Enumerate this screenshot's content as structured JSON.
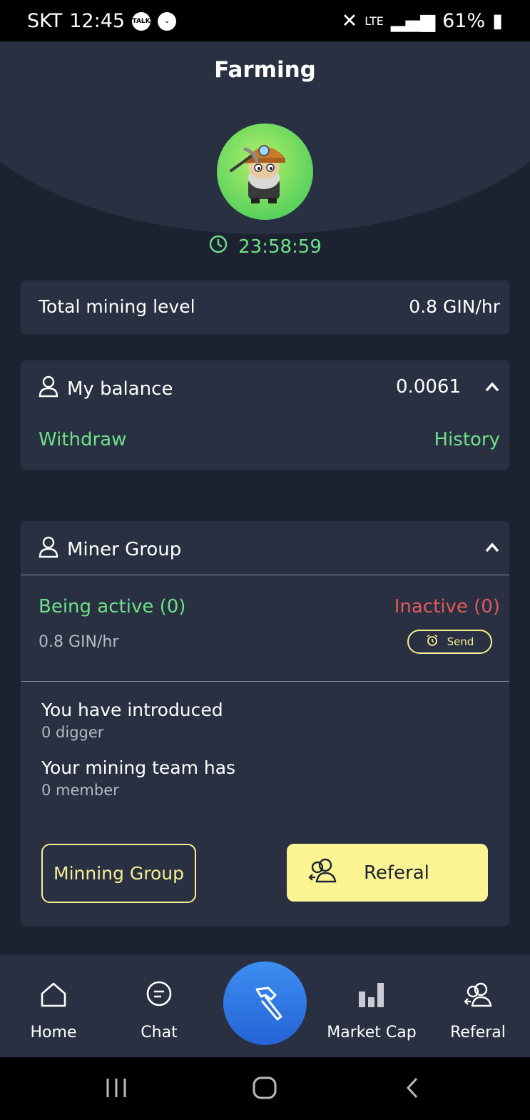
{
  "status_bar": {
    "carrier": "SKT",
    "time": "12:45",
    "talk_icon_text": "TALK",
    "network": "LTE",
    "battery": "61%"
  },
  "header": {
    "title": "Farming"
  },
  "timer": {
    "value": "23:58:59"
  },
  "mining_level": {
    "label": "Total mining level",
    "value": "0.8 GIN/hr"
  },
  "balance": {
    "label": "My balance",
    "value": "0.0061",
    "withdraw": "Withdraw",
    "history": "History"
  },
  "miner_group": {
    "title": "Miner Group",
    "active_label": "Being active (0)",
    "inactive_label": "Inactive (0)",
    "rate": "0.8 GIN/hr",
    "send_label": "Send",
    "introduced_title": "You have introduced",
    "introduced_value": "0 digger",
    "team_title": "Your mining team has",
    "team_value": "0 member",
    "group_button": "Minning Group",
    "referal_button": "Referal"
  },
  "bottom_nav": {
    "home": "Home",
    "chat": "Chat",
    "market_cap": "Market Cap",
    "referal": "Referal"
  },
  "colors": {
    "background": "#1c2230",
    "card": "#283041",
    "accent_green": "#6fe087",
    "inactive_red": "#e25a5a",
    "button_yellow": "#fbf493",
    "fab_blue": "#2f73e3"
  }
}
